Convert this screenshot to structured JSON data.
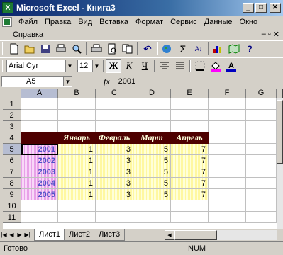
{
  "window": {
    "title": "Microsoft Excel - Книга3",
    "app_icon": "X",
    "controls": {
      "minimize": "_",
      "maximize": "□",
      "close": "✕"
    }
  },
  "menu": {
    "items": [
      "Файл",
      "Правка",
      "Вид",
      "Вставка",
      "Формат",
      "Сервис",
      "Данные",
      "Окно"
    ],
    "items_row2": [
      "Справка"
    ],
    "mdi_controls": {
      "minimize": "–",
      "restore": "▫",
      "close": "✕"
    }
  },
  "toolbar_standard": {
    "icons": [
      "new-icon",
      "open-icon",
      "save-icon",
      "print-preview-icon",
      "search-icon",
      "print-icon",
      "preview-icon",
      "copy-icon",
      "undo-icon",
      "hyperlink-icon",
      "autosum-icon",
      "sort-icon",
      "chart-icon",
      "map-icon",
      "help-icon"
    ],
    "autosum_glyph": "Σ",
    "undo_glyph": "↶",
    "sort_glyph": "А↓",
    "help_glyph": "?"
  },
  "toolbar_format": {
    "font_name": "Arial Cyr",
    "font_size": "12",
    "bold": "Ж",
    "italic": "К",
    "underline": "Ч"
  },
  "formula_bar": {
    "name_box": "A5",
    "fx": "fx",
    "value": "2001"
  },
  "grid": {
    "columns": [
      "A",
      "B",
      "C",
      "D",
      "E",
      "F",
      "G"
    ],
    "rows": [
      "1",
      "2",
      "3",
      "4",
      "5",
      "6",
      "7",
      "8",
      "9",
      "10",
      "11"
    ],
    "header_row": [
      "",
      "Январь",
      "Февраль",
      "Март",
      "Апрель"
    ],
    "data": [
      [
        "2001",
        "1",
        "3",
        "5",
        "7"
      ],
      [
        "2002",
        "1",
        "3",
        "5",
        "7"
      ],
      [
        "2003",
        "1",
        "3",
        "5",
        "7"
      ],
      [
        "2004",
        "1",
        "3",
        "5",
        "7"
      ],
      [
        "2005",
        "1",
        "3",
        "5",
        "7"
      ]
    ],
    "colors": {
      "header_bg": "#4d0000",
      "header_fg": "#ffffdc",
      "year_bg": "#e8a0e8",
      "year_fg": "#5050c8",
      "values_bg": "#fff8a0"
    }
  },
  "sheets": {
    "tabs": [
      "Лист1",
      "Лист2",
      "Лист3"
    ],
    "active": "Лист1"
  },
  "status": {
    "text": "Готово",
    "mode": "NUM"
  }
}
